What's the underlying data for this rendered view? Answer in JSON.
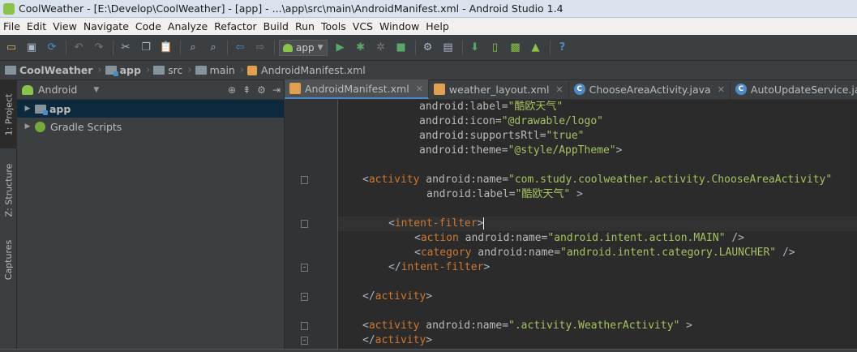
{
  "window": {
    "title": "CoolWeather - [E:\\Develop\\CoolWeather] - [app] - ...\\app\\src\\main\\AndroidManifest.xml - Android Studio 1.4"
  },
  "menu": [
    {
      "label": "File"
    },
    {
      "label": "Edit"
    },
    {
      "label": "View"
    },
    {
      "label": "Navigate"
    },
    {
      "label": "Code"
    },
    {
      "label": "Analyze"
    },
    {
      "label": "Refactor"
    },
    {
      "label": "Build"
    },
    {
      "label": "Run"
    },
    {
      "label": "Tools"
    },
    {
      "label": "VCS"
    },
    {
      "label": "Window"
    },
    {
      "label": "Help"
    }
  ],
  "toolbar": {
    "run_config": "app",
    "icons": [
      "open-folder-icon",
      "save-icon",
      "sync-icon",
      "undo-icon",
      "redo-icon",
      "cut-icon",
      "copy-icon",
      "paste-icon",
      "find-icon",
      "replace-icon",
      "back-icon",
      "forward-icon",
      "run-icon",
      "debug-icon",
      "attach-debugger-icon",
      "stop-icon",
      "sdk-manager-icon",
      "avd-manager-icon",
      "sync-gradle-icon",
      "android-monitor-icon",
      "help-icon"
    ]
  },
  "breadcrumb": [
    {
      "label": "CoolWeather"
    },
    {
      "label": "app"
    },
    {
      "label": "src"
    },
    {
      "label": "main"
    },
    {
      "label": "AndroidManifest.xml"
    }
  ],
  "left_tabs": [
    {
      "label": "1: Project"
    },
    {
      "label": "Z: Structure"
    },
    {
      "label": "Captures"
    }
  ],
  "project": {
    "view": "Android",
    "tree": [
      {
        "label": "app"
      },
      {
        "label": "Gradle Scripts"
      }
    ]
  },
  "tabs": [
    {
      "label": "AndroidManifest.xml",
      "type": "xml"
    },
    {
      "label": "weather_layout.xml",
      "type": "xml"
    },
    {
      "label": "ChooseAreaActivity.java",
      "type": "java"
    },
    {
      "label": "AutoUpdateService.java",
      "type": "java"
    }
  ],
  "code": {
    "l1": {
      "attr": "android:label=",
      "val": "\"酷欧天气\""
    },
    "l2": {
      "attr": "android:icon=",
      "val": "\"@drawable/logo\""
    },
    "l3": {
      "attr": "android:supportsRtl=",
      "val": "\"true\""
    },
    "l4": {
      "attr": "android:theme=",
      "val": "\"@style/AppTheme\"",
      "end": ">"
    },
    "l6": {
      "open": "<",
      "tag": "activity",
      "attr": " android:name=",
      "val": "\"com.study.coolweather.activity.ChooseAreaActivity\""
    },
    "l7": {
      "attr": "android:label=",
      "val": "\"酷欧天气\"",
      "end": " >"
    },
    "l9": {
      "open": "<",
      "tag": "intent-filter",
      "end": ">"
    },
    "l10": {
      "open": "<",
      "tag": "action",
      "attr": " android:name=",
      "val": "\"android.intent.action.MAIN\"",
      "end": " />"
    },
    "l11": {
      "open": "<",
      "tag": "category",
      "attr": " android:name=",
      "val": "\"android.intent.category.LAUNCHER\"",
      "end": " />"
    },
    "l12": {
      "open": "</",
      "tag": "intent-filter",
      "end": ">"
    },
    "l14": {
      "open": "</",
      "tag": "activity",
      "end": ">"
    },
    "l16": {
      "open": "<",
      "tag": "activity",
      "attr": " android:name=",
      "val": "\".activity.WeatherActivity\"",
      "end": " >"
    },
    "l17": {
      "open": "</",
      "tag": "activity",
      "end": ">"
    }
  }
}
